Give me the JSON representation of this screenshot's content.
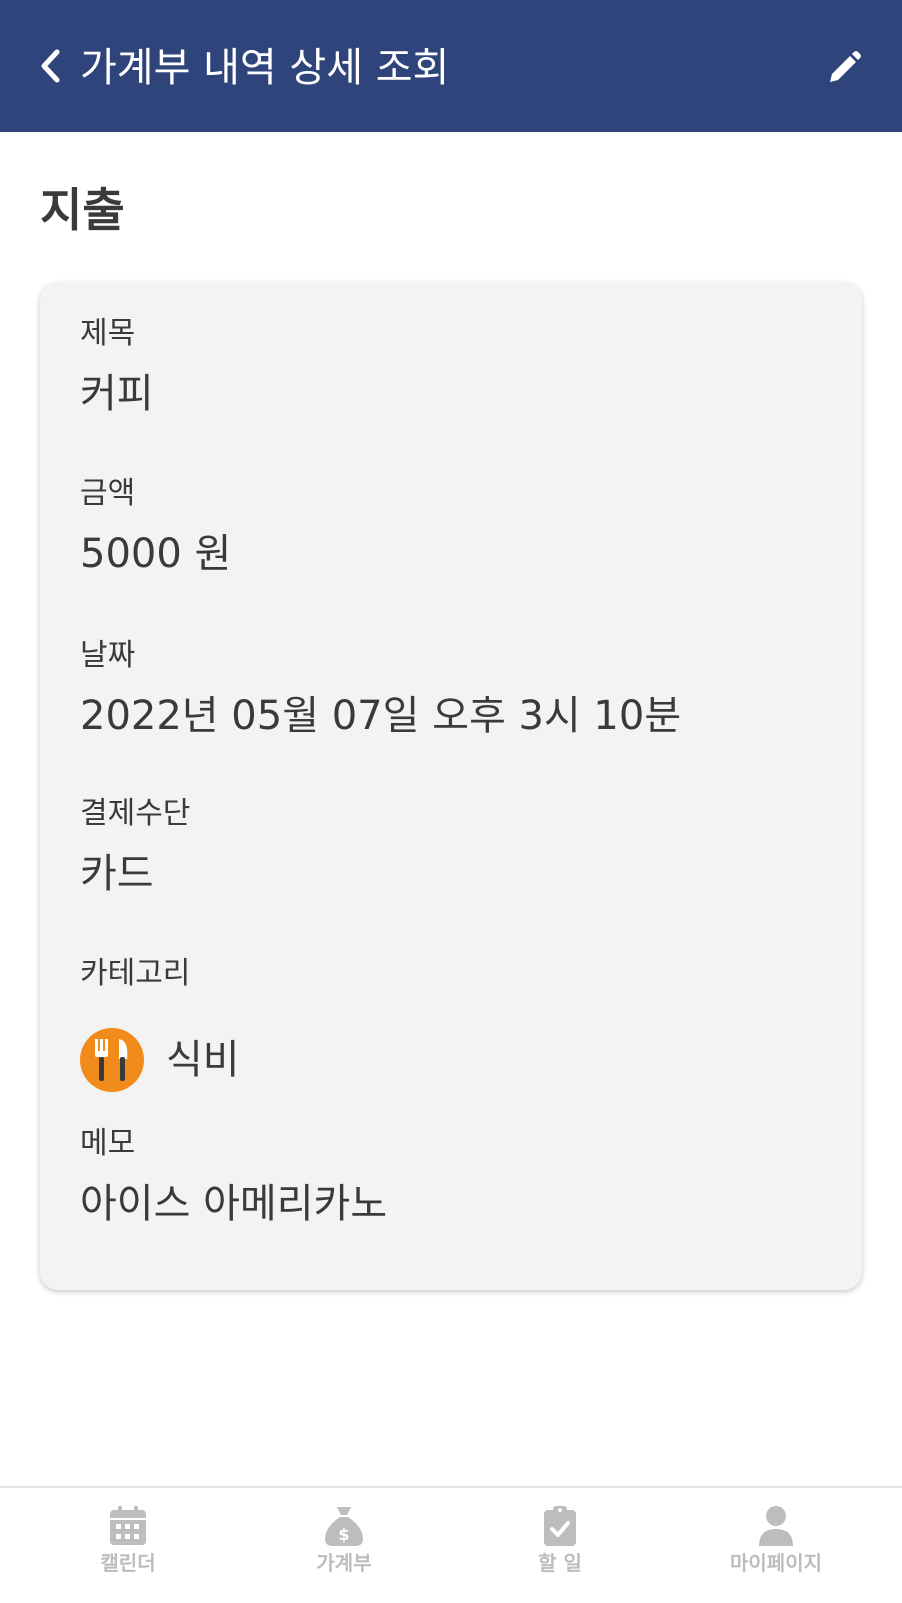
{
  "header": {
    "title": "가계부 내역 상세 조회",
    "background_color": "#2e447b",
    "back_icon": "chevron-left-icon",
    "edit_icon": "pencil-icon"
  },
  "section": {
    "title": "지출"
  },
  "detail": {
    "title_label": "제목",
    "title_value": "커피",
    "amount_label": "금액",
    "amount_value": "5000 원",
    "date_label": "날짜",
    "date_value": "2022년 05월 07일 오후 3시 10분",
    "payment_label": "결제수단",
    "payment_value": "카드",
    "category_label": "카테고리",
    "category_value": "식비",
    "category_icon": "fork-knife-icon",
    "category_icon_color": "#f08b1c",
    "memo_label": "메모",
    "memo_value": "아이스 아메리카노"
  },
  "bottom_nav": {
    "inactive_color": "#bdbdbd",
    "items": [
      {
        "label": "캘린더",
        "icon": "calendar-icon"
      },
      {
        "label": "가계부",
        "icon": "money-bag-icon"
      },
      {
        "label": "할 일",
        "icon": "clipboard-check-icon"
      },
      {
        "label": "마이페이지",
        "icon": "user-icon"
      }
    ]
  }
}
